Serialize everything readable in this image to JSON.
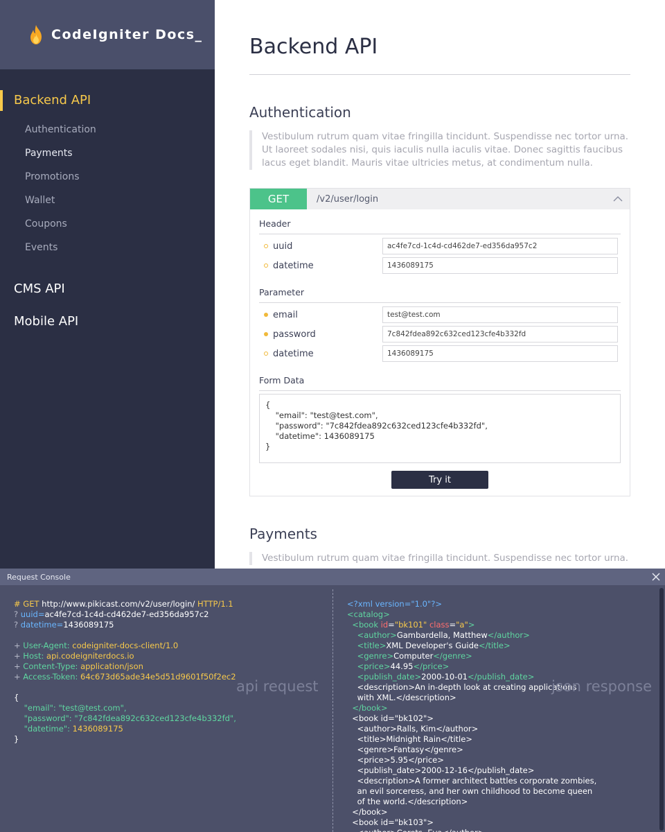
{
  "sidebar": {
    "brand": "CodeIgniter Docs_",
    "groups": [
      {
        "label": "Backend API",
        "items": [
          "Authentication",
          "Payments",
          "Promotions",
          "Wallet",
          "Coupons",
          "Events"
        ]
      },
      {
        "label": "CMS API"
      },
      {
        "label": "Mobile API"
      }
    ]
  },
  "main": {
    "title": "Backend API",
    "sections": [
      {
        "title": "Authentication",
        "description": "Vestibulum rutrum quam vitae fringilla tincidunt. Suspendisse nec tortor urna. Ut laoreet sodales nisi, quis iaculis nulla iaculis vitae. Donec sagittis faucibus lacus eget blandit. Mauris vitae ultricies metus, at condimentum nulla."
      },
      {
        "title": "Payments",
        "description": "Vestibulum rutrum quam vitae fringilla tincidunt. Suspendisse nec tortor urna. Ut"
      }
    ],
    "endpoint": {
      "method": "GET",
      "path": "/v2/user/login",
      "header_title": "Header",
      "header_params": [
        {
          "name": "uuid",
          "value": "ac4fe7cd-1c4d-cd462de7-ed356da957c2",
          "required": false
        },
        {
          "name": "datetime",
          "value": "1436089175",
          "required": false
        }
      ],
      "parameter_title": "Parameter",
      "params": [
        {
          "name": "email",
          "value": "test@test.com",
          "required": true
        },
        {
          "name": "password",
          "value": "7c842fdea892c632ced123cfe4b332fd",
          "required": true
        },
        {
          "name": "datetime",
          "value": "1436089175",
          "required": false
        }
      ],
      "form_data_title": "Form Data",
      "form_data": "{\n    \"email\": \"test@test.com\",\n    \"password\": \"7c842fdea892c632ced123cfe4b332fd\",\n    \"datetime\": 1436089175\n}",
      "try_label": "Try it"
    }
  },
  "console": {
    "title": "Request Console",
    "request": {
      "method_line": {
        "prefix": "# GET",
        "url": "http://www.pikicast.com/v2/user/login/",
        "protocol": "HTTP/1.1"
      },
      "query": [
        {
          "key": "uuid=",
          "value": "ac4fe7cd-1c4d-cd462de7-ed356da957c2"
        },
        {
          "key": "datetime=",
          "value": "1436089175"
        }
      ],
      "headers": [
        {
          "key": "User-Agent:",
          "value": "codeigniter-docs-client/1.0"
        },
        {
          "key": "Host:",
          "value": "api.codeigniterdocs.io"
        },
        {
          "key": "Content-Type:",
          "value": "application/json"
        },
        {
          "key": "Access-Token:",
          "value": "64c673d65ade34e5d51d9601f50f2ec2"
        }
      ],
      "body": [
        {
          "key": "\"email\":",
          "value": "\"test@test.com\","
        },
        {
          "key": "\"password\":",
          "value": "\"7c842fdea892c632ced123cfe4b332fd\","
        },
        {
          "key": "\"datetime\":",
          "value": "1436089175"
        }
      ],
      "label": "api request"
    },
    "response": {
      "lines": [
        "<?xml version=\"1.0\"?>",
        "<catalog>",
        "  <book id=\"bk101\" class=\"a\">",
        "    <author>Gambardella, Matthew</author>",
        "    <title>XML Developer's Guide</title>",
        "    <genre>Computer</genre>",
        "    <price>44.95</price>",
        "    <publish_date>2000-10-01</publish_date>",
        "    <description>An in-depth look at creating applications",
        "    with XML.</description>",
        "  </book>",
        "  <book id=\"bk102\">",
        "    <author>Ralls, Kim</author>",
        "    <title>Midnight Rain</title>",
        "    <genre>Fantasy</genre>",
        "    <price>5.95</price>",
        "    <publish_date>2000-12-16</publish_date>",
        "    <description>A former architect battles corporate zombies,",
        "    an evil sorceress, and her own childhood to become queen",
        "    of the world.</description>",
        "  </book>",
        "  <book id=\"bk103\">",
        "    <author>Corets, Eva</author>"
      ],
      "label": "json response"
    }
  },
  "colors": {
    "sidebar": "#2b2f44",
    "brand_bg": "#4a4f6a",
    "accent": "#f7c94b",
    "method_get": "#4cc38a",
    "console_bg": "#4c5069"
  }
}
